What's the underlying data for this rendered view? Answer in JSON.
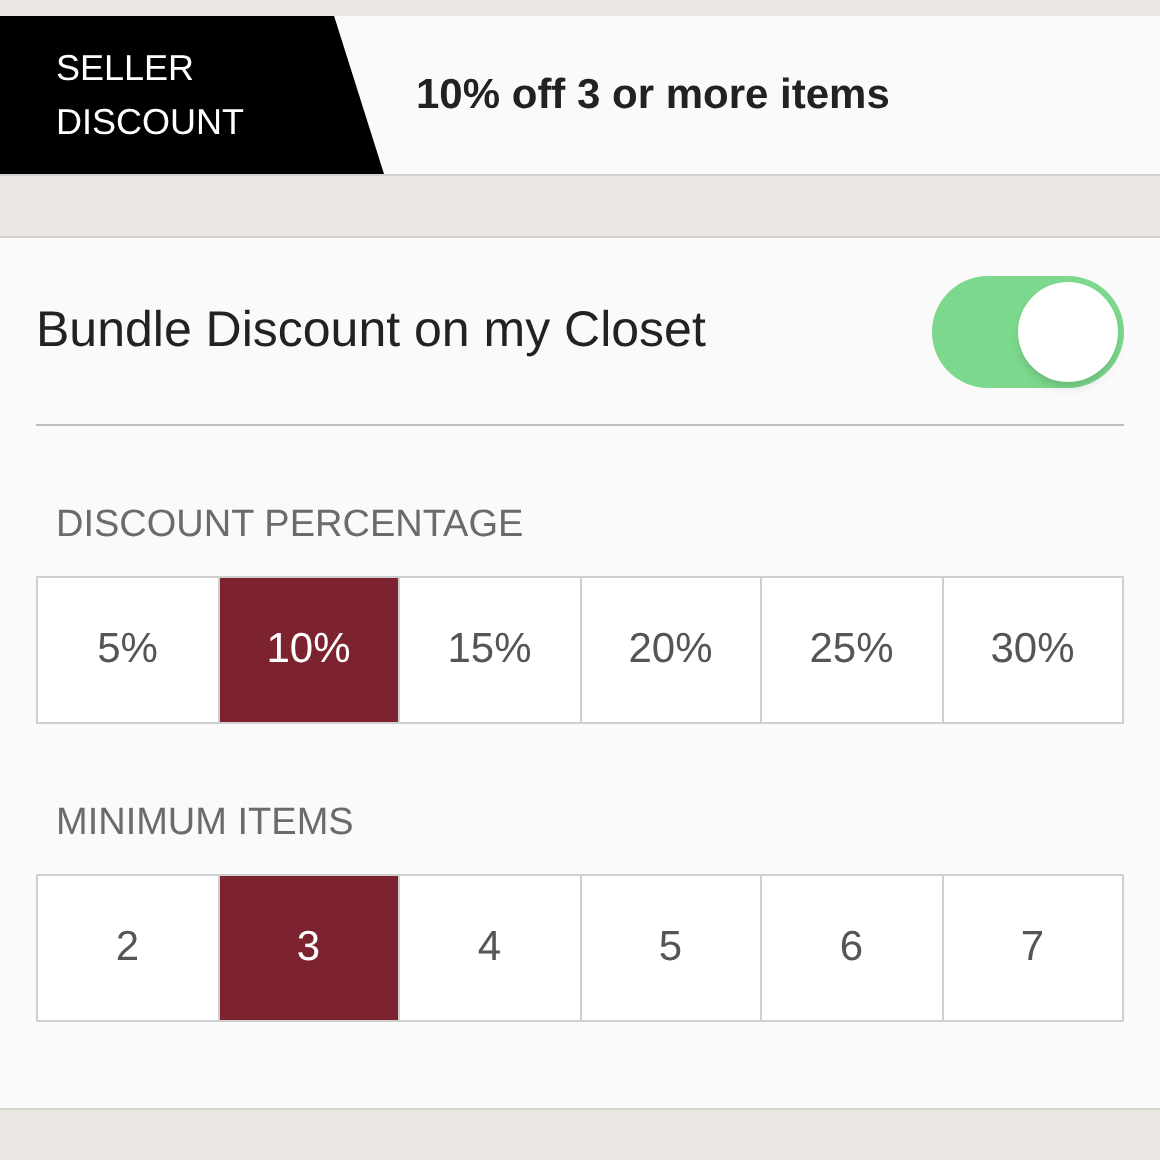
{
  "seller_discount": {
    "tag": "SELLER\nDISCOUNT",
    "summary": "10% off 3 or more items"
  },
  "bundle_toggle": {
    "label": "Bundle Discount on my Closet",
    "on": true
  },
  "discount_percentage": {
    "heading": "DISCOUNT PERCENTAGE",
    "options": [
      {
        "label": "5%",
        "selected": false
      },
      {
        "label": "10%",
        "selected": true
      },
      {
        "label": "15%",
        "selected": false
      },
      {
        "label": "20%",
        "selected": false
      },
      {
        "label": "25%",
        "selected": false
      },
      {
        "label": "30%",
        "selected": false
      }
    ]
  },
  "minimum_items": {
    "heading": "MINIMUM ITEMS",
    "options": [
      {
        "label": "2",
        "selected": false
      },
      {
        "label": "3",
        "selected": true
      },
      {
        "label": "4",
        "selected": false
      },
      {
        "label": "5",
        "selected": false
      },
      {
        "label": "6",
        "selected": false
      },
      {
        "label": "7",
        "selected": false
      }
    ]
  }
}
